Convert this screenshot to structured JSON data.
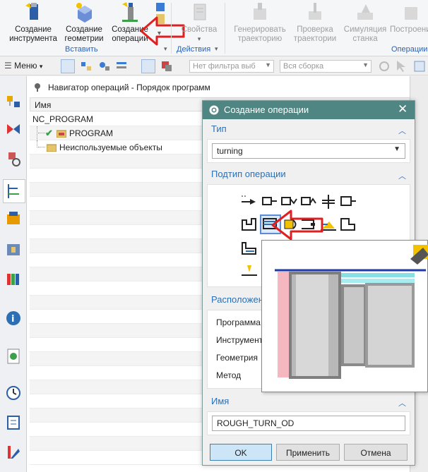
{
  "ribbon": {
    "buttons": [
      {
        "label": "Создание\nинструмента",
        "icon": "create-tool-icon"
      },
      {
        "label": "Создание\nгеометрии",
        "icon": "create-geometry-icon"
      },
      {
        "label": "Создание\nоперации",
        "icon": "create-operation-icon"
      },
      {
        "label": "Свойства",
        "icon": "properties-icon"
      },
      {
        "label": "Генерировать\nтраекторию",
        "icon": "generate-path-icon"
      },
      {
        "label": "Проверка\nтраектории",
        "icon": "verify-path-icon"
      },
      {
        "label": "Симуляция\nстанка",
        "icon": "machine-simulation-icon"
      },
      {
        "label": "Построение",
        "icon": "postprocess-icon"
      }
    ],
    "groups": {
      "insert": "Вставить",
      "actions": "Действия",
      "operations": "Операции"
    }
  },
  "toolbar": {
    "menu_label": "Меню",
    "filter_value": "Нет фильтра выб",
    "assembly_value": "Вся сборка"
  },
  "navigator": {
    "title": "Навигатор операций - Порядок программ",
    "column_name": "Имя",
    "rows": [
      "NC_PROGRAM",
      "PROGRAM",
      "Неиспользуемые объекты"
    ]
  },
  "dialog": {
    "title": "Создание операции",
    "type_section": "Тип",
    "type_value": "turning",
    "subtype_section": "Подтип операции",
    "location_section": "Расположен",
    "fields": [
      "Программа",
      "Инструмент",
      "Геометрия",
      "Метод"
    ],
    "name_section": "Имя",
    "name_value": "ROUGH_TURN_OD",
    "ok": "OK",
    "apply": "Применить",
    "cancel": "Отмена"
  },
  "colors": {
    "accent": "#2c6fb5",
    "dialog_title_bg": "#4f8582",
    "annotation_arrow": "#e02020"
  }
}
